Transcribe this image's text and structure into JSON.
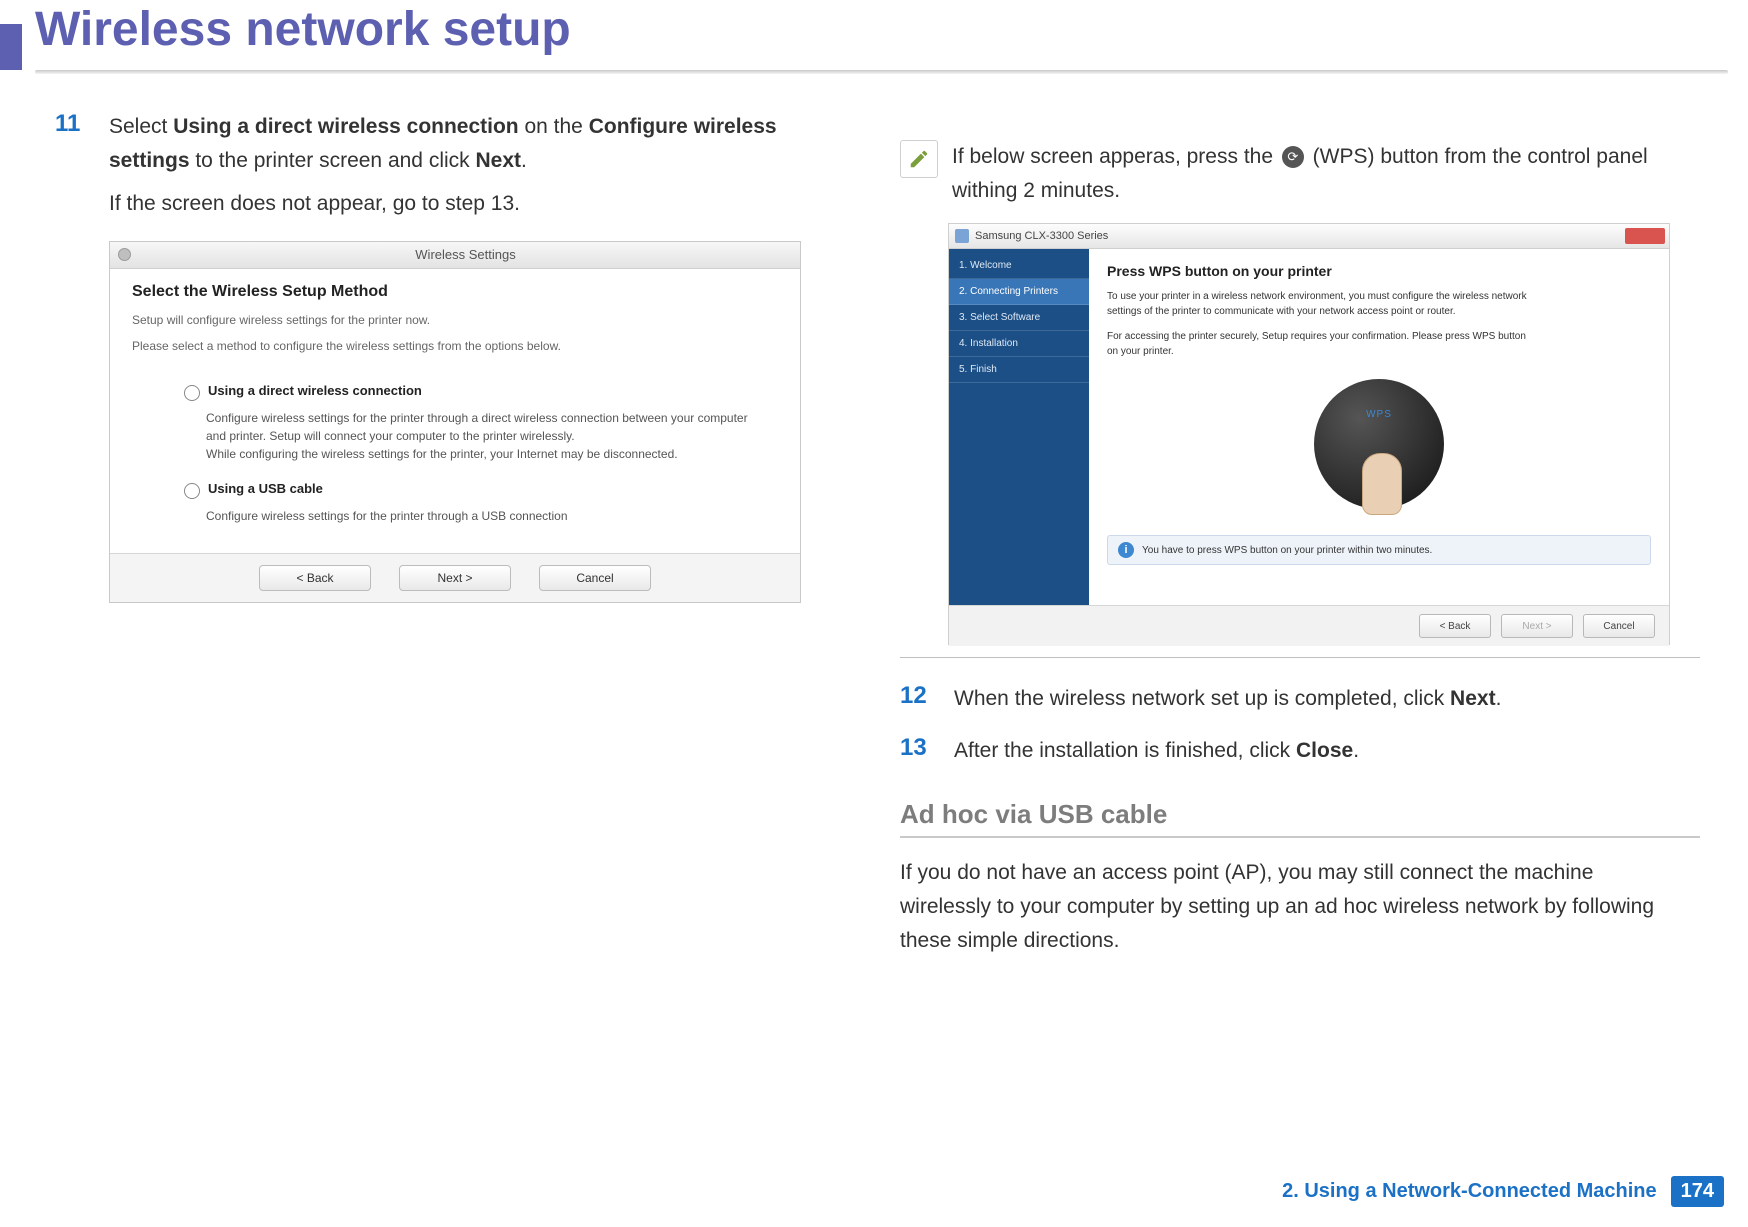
{
  "page": {
    "title": "Wireless network setup",
    "chapter_label": "2.  Using a Network-Connected Machine",
    "page_number": "174"
  },
  "step11": {
    "num": "11",
    "part1": "Select ",
    "bold1": "Using a direct wireless connection",
    "part2": " on the ",
    "bold2": "Configure wireless settings",
    "part3": " to the printer screen and click ",
    "bold3": "Next",
    "part4": ".",
    "line2": "If the screen does not appear, go to step 13."
  },
  "shot1": {
    "window_title": "Wireless Settings",
    "heading": "Select the Wireless Setup Method",
    "sub1": "Setup will configure wireless settings for the printer now.",
    "sub2": "Please select a method to configure the wireless settings from the options below.",
    "opt1_label": "Using a direct wireless connection",
    "opt1_desc": "Configure wireless settings for the printer through a direct wireless connection between your computer and printer. Setup will connect your computer to the printer wirelessly.\nWhile configuring the wireless settings for the printer, your Internet may be disconnected.",
    "opt2_label": "Using a USB cable",
    "opt2_desc": "Configure wireless settings for the printer through a USB connection",
    "btn_back": "< Back",
    "btn_next": "Next >",
    "btn_cancel": "Cancel"
  },
  "note": {
    "part1": "If below screen apperas, press the ",
    "part2": " (WPS) button from the control panel withing 2 minutes."
  },
  "shot2": {
    "window_title": "Samsung CLX-3300 Series",
    "side_items": [
      "1. Welcome",
      "2. Connecting Printers",
      "3. Select Software",
      "4. Installation",
      "5. Finish"
    ],
    "side_active_index": 1,
    "heading": "Press WPS button on your printer",
    "p1": "To use your printer in a wireless network environment, you must configure the wireless network settings of the printer to communicate with your network access point or router.",
    "p2": "For accessing the printer securely, Setup requires your confirmation. Please press WPS button on your printer.",
    "wps_label": "WPS",
    "info_text": "You have to press WPS button on your printer within two minutes.",
    "btn_back": "< Back",
    "btn_next": "Next >",
    "btn_cancel": "Cancel"
  },
  "step12": {
    "num": "12",
    "part1": "When the wireless network set up is completed, click ",
    "bold1": "Next",
    "part2": "."
  },
  "step13": {
    "num": "13",
    "part1": "After the installation is finished, click ",
    "bold1": "Close",
    "part2": "."
  },
  "section": {
    "heading": "Ad hoc via USB cable",
    "para": "If you do not have an access point (AP), you may still connect the machine wirelessly to your computer by setting up an ad hoc wireless network by following these simple directions."
  }
}
